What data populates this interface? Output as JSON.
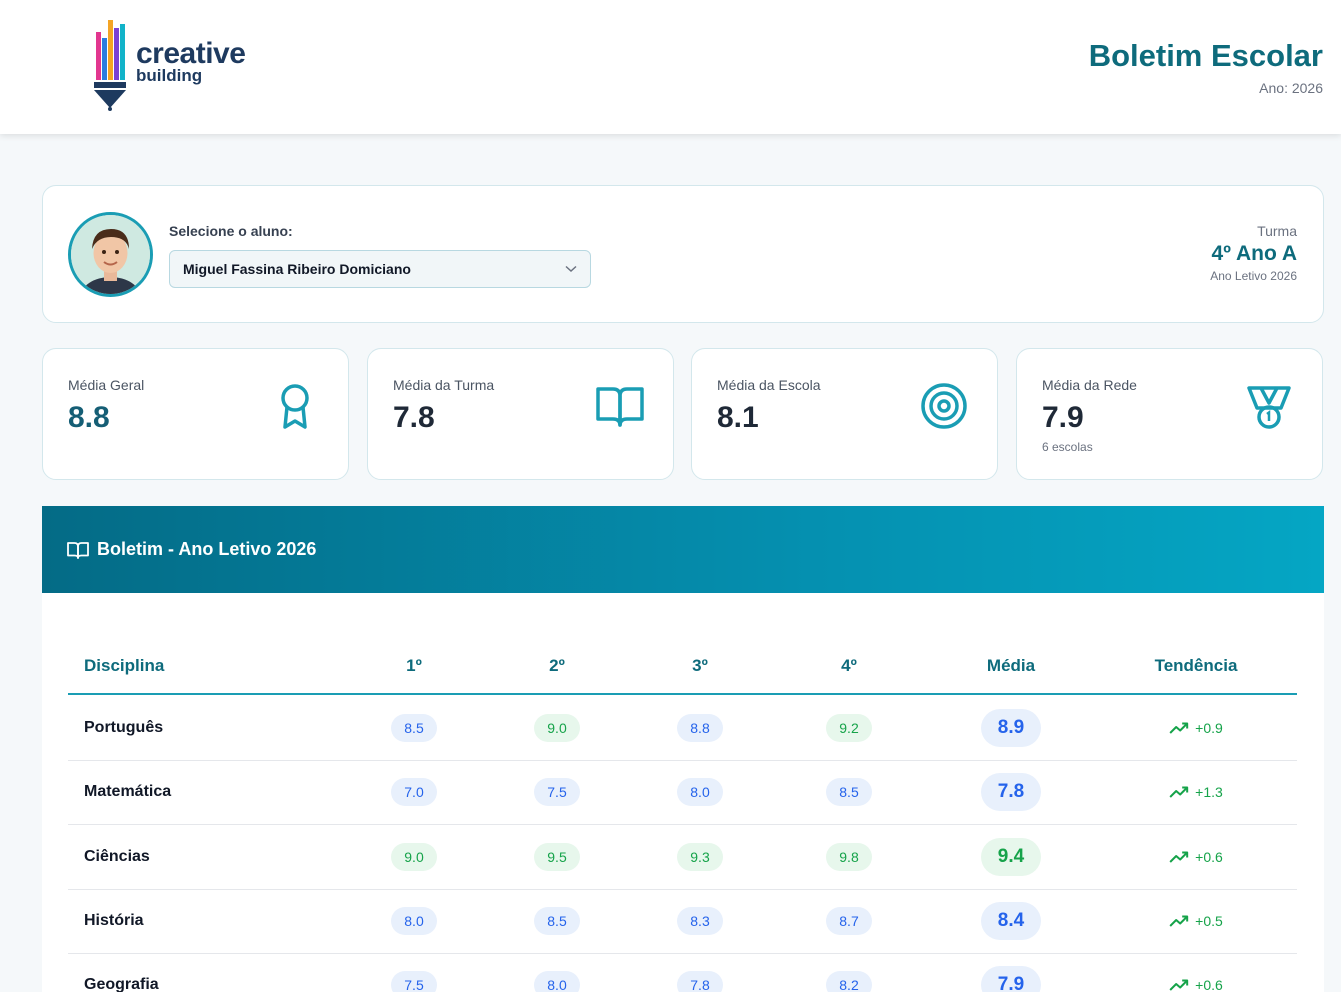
{
  "header": {
    "logo_word1": "creative",
    "logo_word2": "building",
    "title": "Boletim Escolar",
    "year": "Ano: 2026"
  },
  "student": {
    "select_label": "Selecione o aluno:",
    "selected_name": "Miguel Fassina Ribeiro Domiciano",
    "turma_label": "Turma",
    "turma_value": "4º Ano A",
    "turma_sub": "Ano Letivo 2026"
  },
  "stats": [
    {
      "label": "Média Geral",
      "value": "8.8",
      "sub": "",
      "icon": "award-ribbon-icon"
    },
    {
      "label": "Média da Turma",
      "value": "7.8",
      "sub": "",
      "icon": "open-book-icon"
    },
    {
      "label": "Média da Escola",
      "value": "8.1",
      "sub": "",
      "icon": "target-icon"
    },
    {
      "label": "Média da Rede",
      "value": "7.9",
      "sub": "6 escolas",
      "icon": "medal-icon"
    }
  ],
  "report": {
    "title": "Boletim - Ano Letivo 2026",
    "columns": [
      "Disciplina",
      "1º",
      "2º",
      "3º",
      "4º",
      "Média",
      "Tendência"
    ],
    "rows": [
      {
        "subject": "Português",
        "grades": [
          "8.5",
          "9.0",
          "8.8",
          "9.2"
        ],
        "average": "8.9",
        "trend": "+0.9"
      },
      {
        "subject": "Matemática",
        "grades": [
          "7.0",
          "7.5",
          "8.0",
          "8.5"
        ],
        "average": "7.8",
        "trend": "+1.3"
      },
      {
        "subject": "Ciências",
        "grades": [
          "9.0",
          "9.5",
          "9.3",
          "9.8"
        ],
        "average": "9.4",
        "trend": "+0.6"
      },
      {
        "subject": "História",
        "grades": [
          "8.0",
          "8.5",
          "8.3",
          "8.7"
        ],
        "average": "8.4",
        "trend": "+0.5"
      },
      {
        "subject": "Geografia",
        "grades": [
          "7.5",
          "8.0",
          "7.8",
          "8.2"
        ],
        "average": "7.9",
        "trend": "+0.6"
      }
    ]
  },
  "colors": {
    "primary": "#0e6b7c",
    "accent": "#1a9db4",
    "grade_high": "#16a34a",
    "grade_normal": "#2563eb"
  }
}
